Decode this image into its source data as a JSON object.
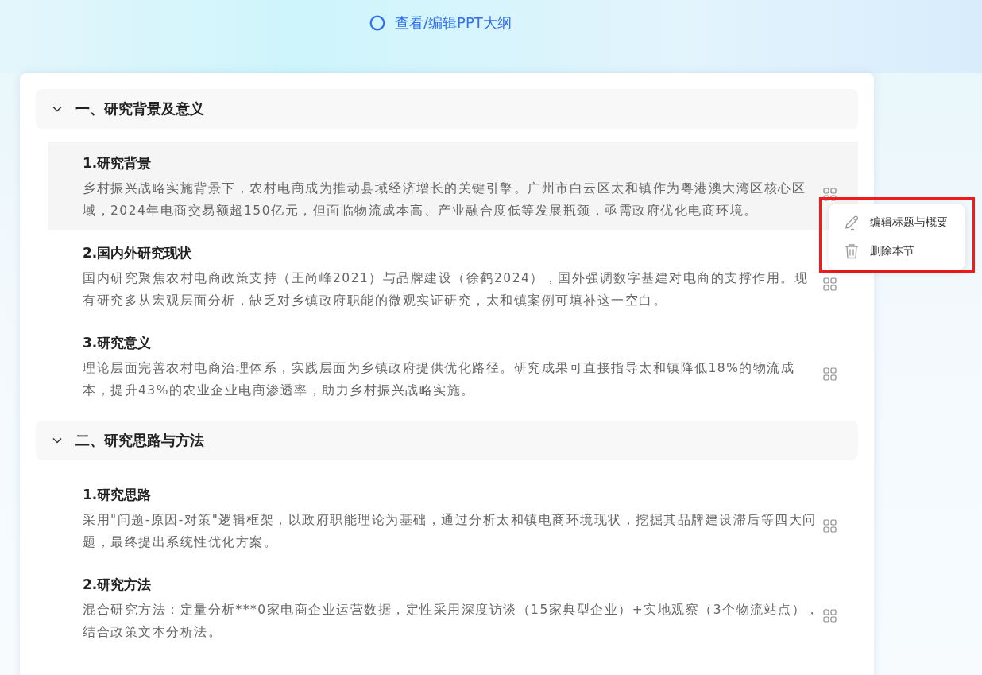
{
  "header": {
    "title": "查看/编辑PPT大纲"
  },
  "sections": [
    {
      "title": "一、研究背景及意义",
      "expanded": true,
      "items": [
        {
          "title": "1.研究背景",
          "summary": "乡村振兴战略实施背景下，农村电商成为推动县域经济增长的关键引擎。广州市白云区太和镇作为粤港澳大湾区核心区域，2024年电商交易额超150亿元，但面临物流成本高、产业融合度低等发展瓶颈，亟需政府优化电商环境。",
          "hovered": true
        },
        {
          "title": "2.国内外研究现状",
          "summary": "国内研究聚焦农村电商政策支持（王尚峰2021）与品牌建设（徐鹤2024），国外强调数字基建对电商的支撑作用。现有研究多从宏观层面分析，缺乏对乡镇政府职能的微观实证研究，太和镇案例可填补这一空白。",
          "hovered": false
        },
        {
          "title": "3.研究意义",
          "summary": "理论层面完善农村电商治理体系，实践层面为乡镇政府提供优化路径。研究成果可直接指导太和镇降低18%的物流成本，提升43%的农业企业电商渗透率，助力乡村振兴战略实施。",
          "hovered": false
        }
      ]
    },
    {
      "title": "二、研究思路与方法",
      "expanded": true,
      "items": [
        {
          "title": "1.研究思路",
          "summary": "采用\"问题-原因-对策\"逻辑框架，以政府职能理论为基础，通过分析太和镇电商环境现状，挖掘其品牌建设滞后等四大问题，最终提出系统性优化方案。",
          "hovered": false
        },
        {
          "title": "2.研究方法",
          "summary": "混合研究方法：定量分析***0家电商企业运营数据，定性采用深度访谈（15家典型企业）+实地观察（3个物流站点），结合政策文本分析法。",
          "hovered": false
        }
      ]
    }
  ],
  "context_menu": {
    "highlighted": true,
    "items": [
      {
        "kind": "edit",
        "label": "编辑标题与概要"
      },
      {
        "kind": "delete",
        "label": "删除本节"
      }
    ]
  }
}
